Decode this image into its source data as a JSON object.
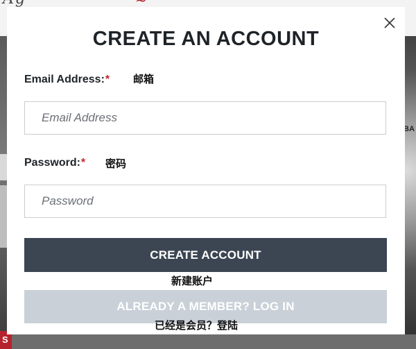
{
  "modal": {
    "title": "CREATE AN ACCOUNT",
    "email": {
      "label": "Email Address:",
      "required_mark": "*",
      "annotation": "邮箱",
      "placeholder": "Email Address",
      "value": ""
    },
    "password": {
      "label": "Password:",
      "required_mark": "*",
      "annotation": "密码",
      "placeholder": "Password",
      "value": ""
    },
    "create_button": {
      "label": "CREATE ACCOUNT",
      "annotation": "新建账户"
    },
    "login_button": {
      "label": "ALREADY A MEMBER? LOG IN",
      "annotation": "已经是会员？登陆"
    },
    "close_icon": "close-icon"
  },
  "background": {
    "left_badge": "S",
    "right_label": "BA"
  },
  "colors": {
    "primary_button": "#3c4652",
    "secondary_button": "#c9d0d8",
    "required": "#c1272d",
    "text": "#1e2328"
  }
}
